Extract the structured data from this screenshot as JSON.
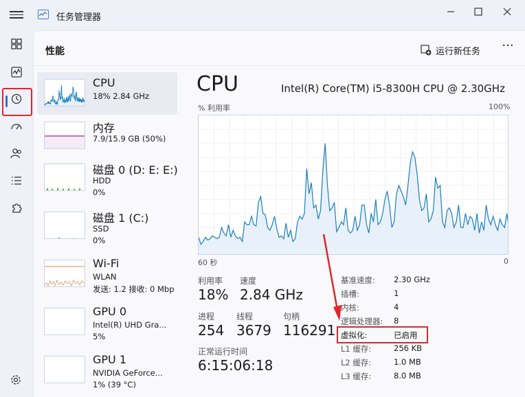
{
  "app": {
    "title": "任务管理器"
  },
  "header": {
    "section_title": "性能",
    "run_task_label": "运行新任务",
    "more_label": "···"
  },
  "sidebar": [
    {
      "title": "CPU",
      "line1": "18%  2.84 GHz",
      "line2": ""
    },
    {
      "title": "内存",
      "line1": "7.9/15.9 GB (50%)",
      "line2": ""
    },
    {
      "title": "磁盘 0 (D: E: E:)",
      "line1": "HDD",
      "line2": "0%"
    },
    {
      "title": "磁盘 1 (C:)",
      "line1": "SSD",
      "line2": "0%"
    },
    {
      "title": "Wi-Fi",
      "line1": "WLAN",
      "line2": "发送: 1.2  接收: 0 Mbp"
    },
    {
      "title": "GPU 0",
      "line1": "Intel(R) UHD Gra...",
      "line2": "5%"
    },
    {
      "title": "GPU 1",
      "line1": "NVIDIA GeForce...",
      "line2": "1% (39 °C)"
    }
  ],
  "cpu": {
    "title": "CPU",
    "model": "Intel(R) Core(TM) i5-8300H CPU @ 2.30GHz",
    "util_axis_label": "% 利用率",
    "max_label": "100%",
    "time_left": "60 秒",
    "time_right": "0",
    "stats": {
      "utilization_label": "利用率",
      "utilization": "18%",
      "speed_label": "速度",
      "speed": "2.84 GHz",
      "processes_label": "进程",
      "processes": "254",
      "threads_label": "线程",
      "threads": "3679",
      "handles_label": "句柄",
      "handles": "116291",
      "uptime_label": "正常运行时间",
      "uptime": "6:15:06:18"
    },
    "info": [
      {
        "label": "基准速度:",
        "value": "2.30 GHz"
      },
      {
        "label": "插槽:",
        "value": "1"
      },
      {
        "label": "内核:",
        "value": "4"
      },
      {
        "label": "逻辑处理器:",
        "value": "8"
      },
      {
        "label": "虚拟化:",
        "value": "已启用"
      },
      {
        "label": "L1 缓存:",
        "value": "256 KB"
      },
      {
        "label": "L2 缓存:",
        "value": "1.0 MB"
      },
      {
        "label": "L3 缓存:",
        "value": "8.0 MB"
      }
    ],
    "usage_history": [
      13,
      8,
      10,
      13,
      11,
      12,
      14,
      13,
      12,
      13,
      20,
      16,
      14,
      22,
      13,
      18,
      14,
      12,
      13,
      10,
      24,
      22,
      22,
      28,
      22,
      21,
      38,
      42,
      30,
      29,
      20,
      18,
      22,
      28,
      19,
      13,
      14,
      12,
      23,
      13,
      18,
      10,
      12,
      24,
      28,
      26,
      30,
      62,
      44,
      52,
      34,
      36,
      26,
      32,
      60,
      80,
      50,
      32,
      34,
      38,
      17,
      20,
      24,
      22,
      34,
      18,
      16,
      18,
      28,
      18,
      22,
      36,
      36,
      22,
      16,
      30,
      24,
      40,
      22,
      24,
      30,
      40,
      46,
      36,
      20,
      24,
      44,
      50,
      46,
      42,
      36,
      50,
      66,
      74,
      70,
      58,
      40,
      32,
      34,
      44,
      24,
      26,
      32,
      56,
      48,
      50,
      24,
      20,
      32,
      34,
      30,
      20,
      24,
      36,
      20,
      20,
      30,
      22,
      28,
      26,
      18,
      30,
      16,
      24,
      18,
      36,
      26,
      22,
      28,
      22,
      18,
      26,
      22,
      20,
      30,
      18
    ]
  },
  "colors": {
    "cpu_line": "#1a7fb7",
    "cpu_fill": "#e8f1fa",
    "highlight": "#e0252c",
    "memory_line": "#8e2d9e",
    "disk_line": "#4c9a2a",
    "wifi_line": "#c8641e"
  }
}
